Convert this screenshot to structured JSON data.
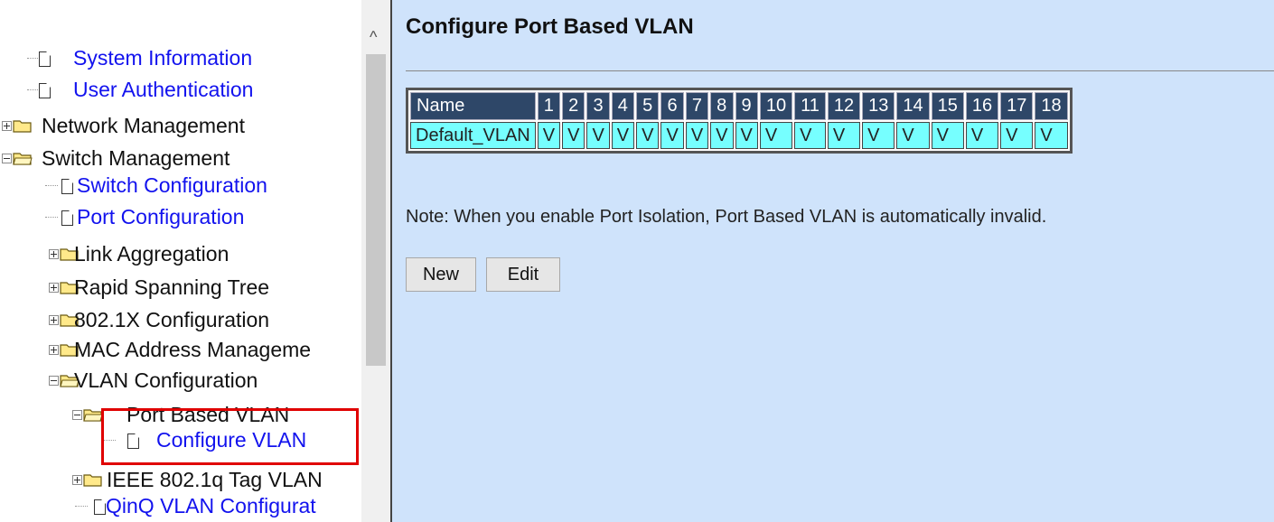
{
  "nav": {
    "items": [
      {
        "label": "System Information"
      },
      {
        "label": "User Authentication"
      },
      {
        "label": "Network Management"
      },
      {
        "label": "Switch Management"
      },
      {
        "label": "Switch Configuration"
      },
      {
        "label": "Port Configuration"
      },
      {
        "label": "Link Aggregation"
      },
      {
        "label": "Rapid Spanning Tree"
      },
      {
        "label": "802.1X Configuration"
      },
      {
        "label": "MAC Address Manageme"
      },
      {
        "label": "VLAN Configuration"
      },
      {
        "label": "Port Based VLAN"
      },
      {
        "label": "Configure VLAN"
      },
      {
        "label": "IEEE 802.1q Tag VLAN"
      },
      {
        "label": "QinQ VLAN Configurat"
      }
    ]
  },
  "main": {
    "title": "Configure Port Based VLAN",
    "table": {
      "headers": [
        "Name",
        "1",
        "2",
        "3",
        "4",
        "5",
        "6",
        "7",
        "8",
        "9",
        "10",
        "11",
        "12",
        "13",
        "14",
        "15",
        "16",
        "17",
        "18"
      ],
      "rows": [
        [
          "Default_VLAN",
          "V",
          "V",
          "V",
          "V",
          "V",
          "V",
          "V",
          "V",
          "V",
          "V",
          "V",
          "V",
          "V",
          "V",
          "V",
          "V",
          "V",
          "V"
        ]
      ]
    },
    "note": "Note: When you enable Port Isolation, Port Based VLAN is automatically invalid.",
    "new_label": "New",
    "edit_label": "Edit"
  },
  "colors": {
    "header_bg": "#2e4768",
    "row_bg": "#76ffff",
    "link": "#1212ee",
    "page_bg": "#cfe3fb",
    "highlight": "#e00000"
  }
}
